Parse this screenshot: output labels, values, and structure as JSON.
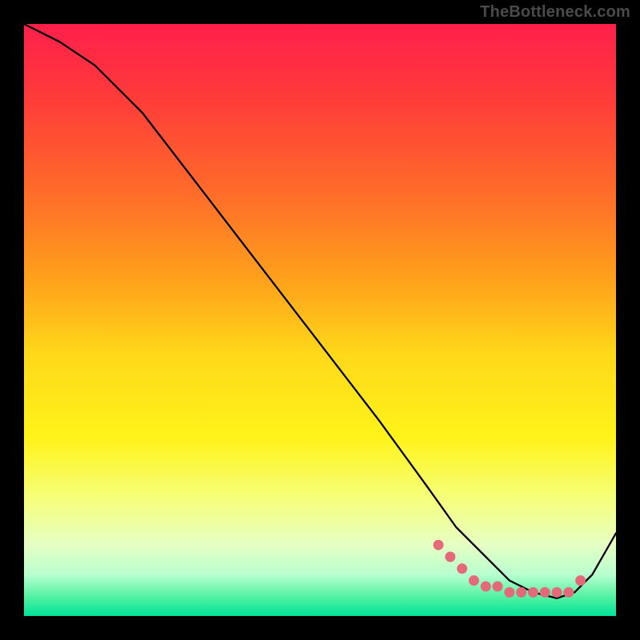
{
  "attribution": "TheBottleneck.com",
  "chart_data": {
    "type": "line",
    "title": "",
    "xlabel": "",
    "ylabel": "",
    "xlim": [
      0,
      100
    ],
    "ylim": [
      0,
      100
    ],
    "series": [
      {
        "name": "curve",
        "x": [
          0,
          6,
          12,
          20,
          30,
          40,
          50,
          60,
          68,
          73,
          78,
          82,
          86,
          90,
          93,
          96,
          100
        ],
        "y": [
          100,
          97,
          93,
          85,
          72,
          59,
          46,
          33,
          22,
          15,
          10,
          6,
          4,
          3,
          4,
          7,
          14
        ]
      }
    ],
    "markers": {
      "name": "bottom-cluster",
      "style": "filled-circle",
      "color": "#e46a7a",
      "x": [
        70,
        72,
        74,
        76,
        78,
        80,
        82,
        84,
        86,
        88,
        90,
        92,
        94
      ],
      "y": [
        12,
        10,
        8,
        6,
        5,
        5,
        4,
        4,
        4,
        4,
        4,
        4,
        6
      ]
    }
  }
}
